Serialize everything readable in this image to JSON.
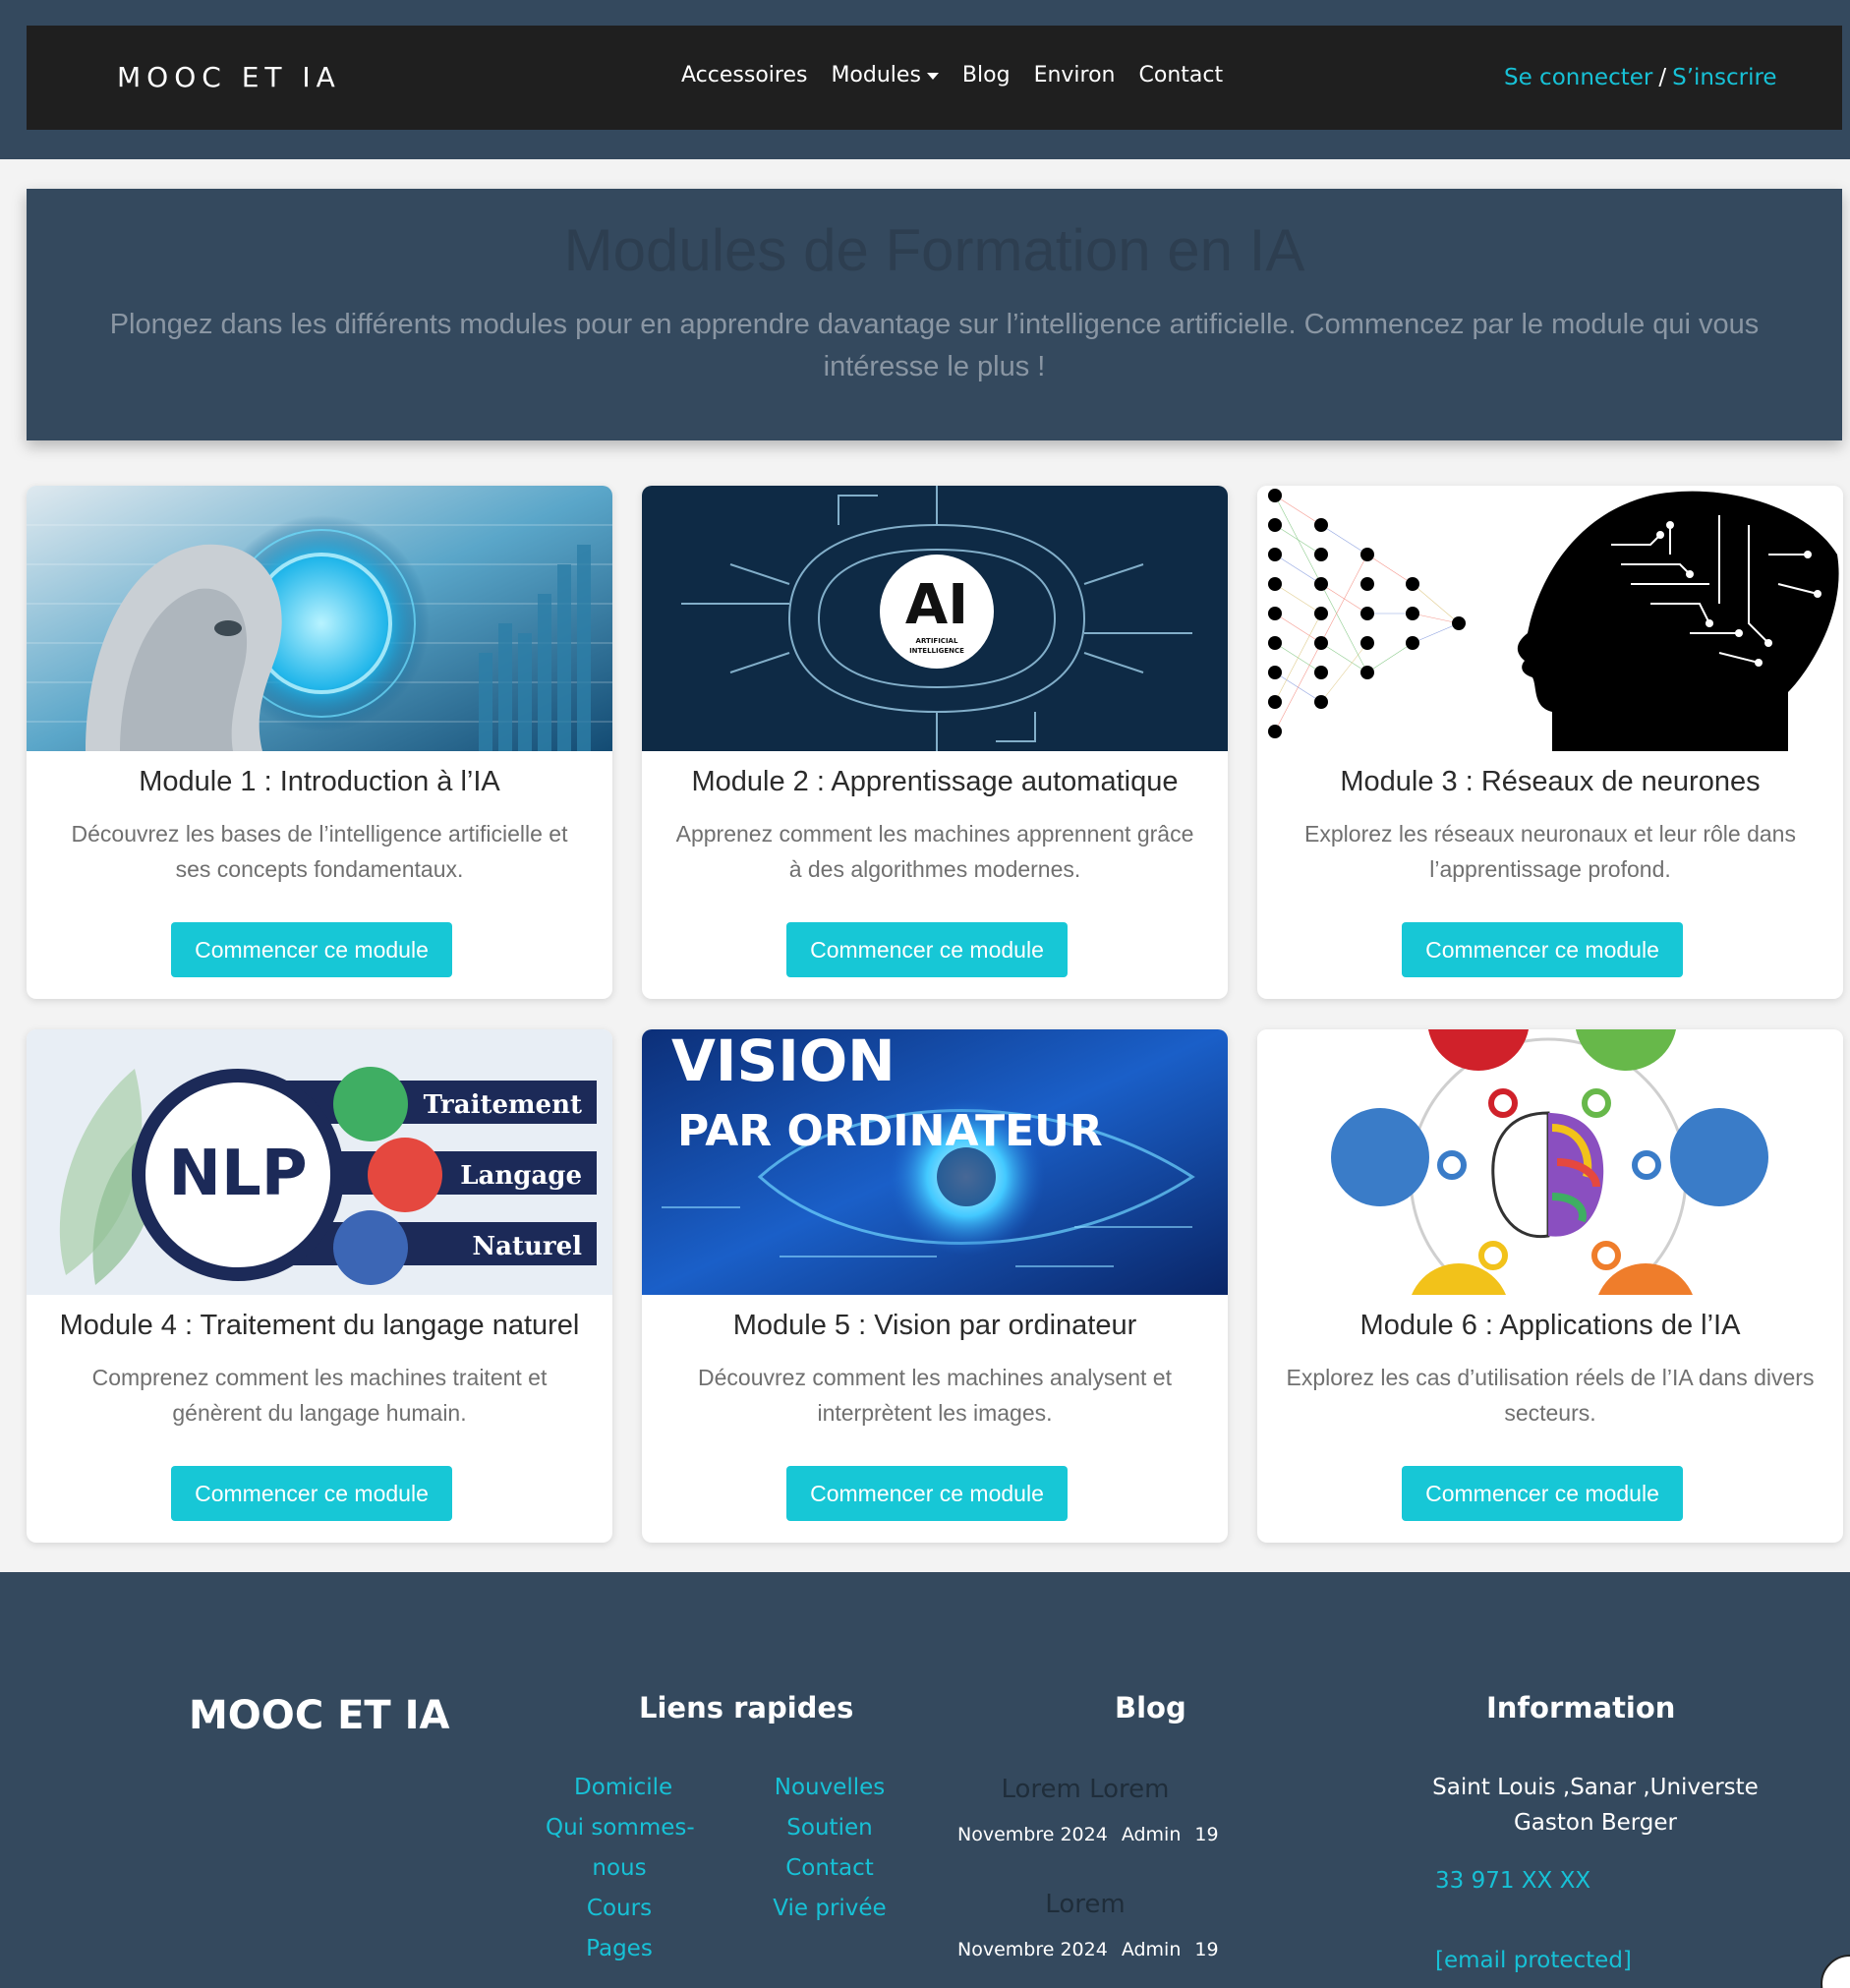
{
  "navbar": {
    "brand": "MOOC ET IA",
    "links": [
      {
        "label": "Accessoires"
      },
      {
        "label": "Modules"
      },
      {
        "label": "Blog"
      },
      {
        "label": "Environ"
      },
      {
        "label": "Contact"
      }
    ],
    "login": "Se connecter",
    "separator": "/",
    "register": "S’inscrire"
  },
  "hero": {
    "title": "Modules de Formation en IA",
    "subtitle": "Plongez dans les différents modules pour en apprendre davantage sur l’intelligence artificielle. Commencez par le module qui vous intéresse le plus !"
  },
  "modules": [
    {
      "title": "Module 1 : Introduction à l’IA",
      "text": "Découvrez les bases de l’intelligence artificielle et ses concepts fondamentaux.",
      "button": "Commencer ce module"
    },
    {
      "title": "Module 2 : Apprentissage automatique",
      "text": "Apprenez comment les machines apprennent grâce à des algorithmes modernes.",
      "button": "Commencer ce module",
      "image_text": {
        "main": "AI",
        "sub1": "ARTIFICIAL",
        "sub2": "INTELLIGENCE"
      }
    },
    {
      "title": "Module 3 : Réseaux de neurones",
      "text": "Explorez les réseaux neuronaux et leur rôle dans l’apprentissage profond.",
      "button": "Commencer ce module"
    },
    {
      "title": "Module 4 : Traitement du langage naturel",
      "text": "Comprenez comment les machines traitent et génèrent du langage humain.",
      "button": "Commencer ce module",
      "image_text": {
        "main": "NLP",
        "row1": "Traitement",
        "row2": "Langage",
        "row3": "Naturel"
      }
    },
    {
      "title": "Module 5 : Vision par ordinateur",
      "text": "Découvrez comment les machines analysent et interprètent les images.",
      "button": "Commencer ce module",
      "image_text": {
        "line1": "VISION",
        "line2": "PAR ORDINATEUR"
      }
    },
    {
      "title": "Module 6 : Applications de l’IA",
      "text": "Explorez les cas d’utilisation réels de l’IA dans divers secteurs.",
      "button": "Commencer ce module"
    }
  ],
  "footer": {
    "brand": "MOOC ET IA",
    "quick_links": {
      "heading": "Liens rapides",
      "col1": [
        "Domicile",
        "Qui sommes-",
        "nous",
        "Cours",
        "Pages"
      ],
      "col2": [
        "Nouvelles",
        "Soutien",
        "Contact",
        "Vie privée"
      ]
    },
    "blog": {
      "heading": "Blog",
      "posts": [
        {
          "title": "Lorem Lorem",
          "date": "Novembre 2024",
          "author": "Admin",
          "count": "19"
        },
        {
          "title": "Lorem",
          "date": "Novembre 2024",
          "author": "Admin",
          "count": "19"
        }
      ]
    },
    "info": {
      "heading": "Information",
      "address_line1": "Saint Louis ,Sanar ,Universte",
      "address_line2": "Gaston Berger",
      "phone": "33 971 XX XX",
      "email": "[email protected]"
    }
  }
}
